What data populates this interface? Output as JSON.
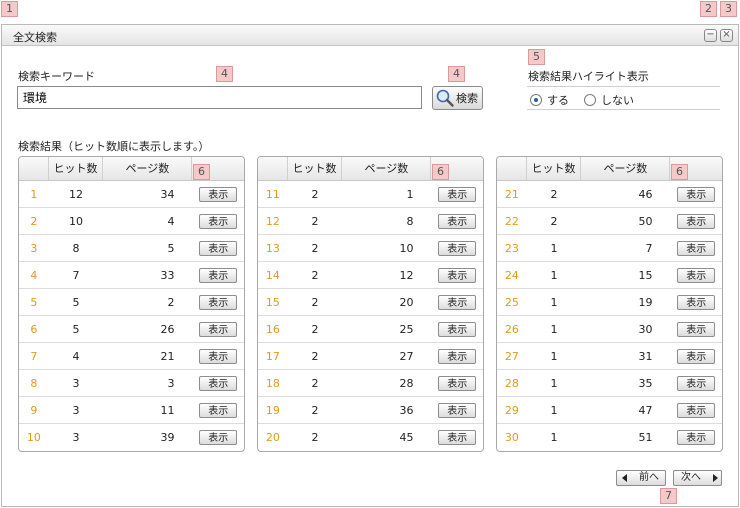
{
  "markers": [
    "1",
    "2",
    "3",
    "4",
    "4",
    "5",
    "6",
    "6",
    "6",
    "7"
  ],
  "window": {
    "title": "全文検索",
    "minimize_icon": "−",
    "close_icon": "×"
  },
  "search": {
    "keyword_label": "検索キーワード",
    "keyword_value": "環境",
    "button_label": "検索"
  },
  "highlight": {
    "label": "検索結果ハイライト表示",
    "options": [
      "する",
      "しない"
    ],
    "selected": "する"
  },
  "results": {
    "label": "検索結果（ヒット数順に表示します。）",
    "headers": [
      "",
      "ヒット数",
      "ページ数",
      ""
    ],
    "button_label": "表示",
    "tables": [
      [
        [
          "1",
          "12",
          "34"
        ],
        [
          "2",
          "10",
          "4"
        ],
        [
          "3",
          "8",
          "5"
        ],
        [
          "4",
          "7",
          "33"
        ],
        [
          "5",
          "5",
          "2"
        ],
        [
          "6",
          "5",
          "26"
        ],
        [
          "7",
          "4",
          "21"
        ],
        [
          "8",
          "3",
          "3"
        ],
        [
          "9",
          "3",
          "11"
        ],
        [
          "10",
          "3",
          "39"
        ]
      ],
      [
        [
          "11",
          "2",
          "1"
        ],
        [
          "12",
          "2",
          "8"
        ],
        [
          "13",
          "2",
          "10"
        ],
        [
          "14",
          "2",
          "12"
        ],
        [
          "15",
          "2",
          "20"
        ],
        [
          "16",
          "2",
          "25"
        ],
        [
          "17",
          "2",
          "27"
        ],
        [
          "18",
          "2",
          "28"
        ],
        [
          "19",
          "2",
          "36"
        ],
        [
          "20",
          "2",
          "45"
        ]
      ],
      [
        [
          "21",
          "2",
          "46"
        ],
        [
          "22",
          "2",
          "50"
        ],
        [
          "23",
          "1",
          "7"
        ],
        [
          "24",
          "1",
          "15"
        ],
        [
          "25",
          "1",
          "19"
        ],
        [
          "26",
          "1",
          "30"
        ],
        [
          "27",
          "1",
          "31"
        ],
        [
          "28",
          "1",
          "35"
        ],
        [
          "29",
          "1",
          "47"
        ],
        [
          "30",
          "1",
          "51"
        ]
      ]
    ]
  },
  "pager": {
    "prev_label": "前へ",
    "next_label": "次へ"
  },
  "colors": {
    "number_accent": "#e09a1e",
    "marker_bg": "#f5c9c9"
  }
}
